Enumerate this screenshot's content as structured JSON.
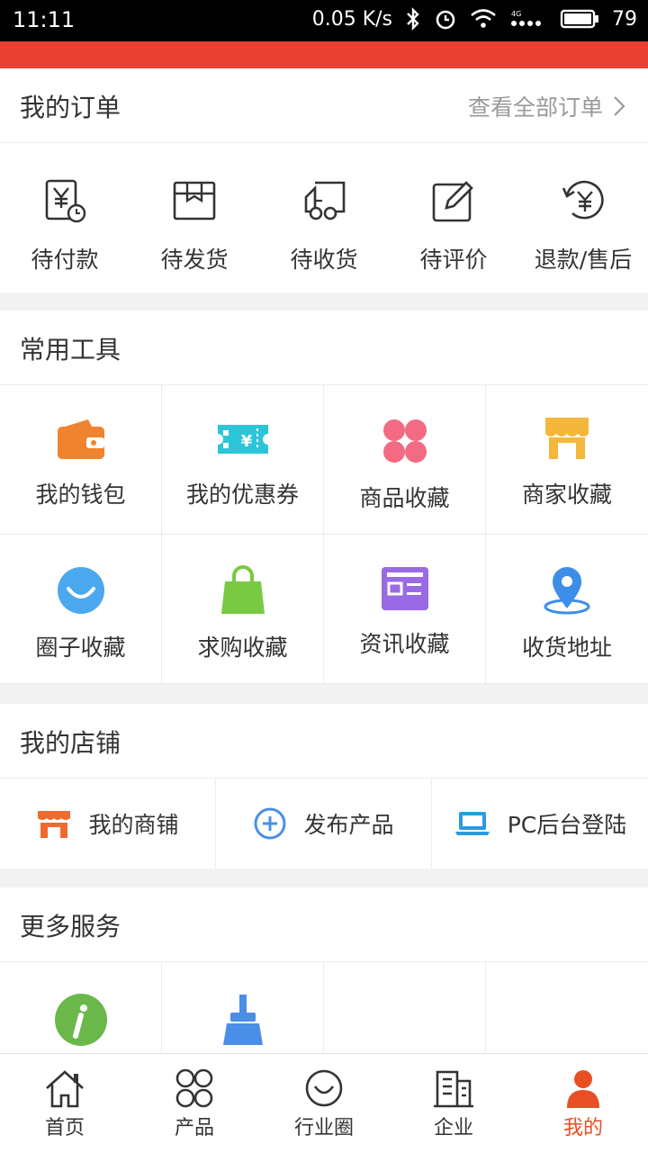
{
  "status": {
    "time": "11:11",
    "speed": "0.05 K/s",
    "battery": "79"
  },
  "orders": {
    "title": "我的订单",
    "view_all": "查看全部订单",
    "items": [
      {
        "label": "待付款",
        "icon": "yuan-clock-icon"
      },
      {
        "label": "待发货",
        "icon": "package-box-icon"
      },
      {
        "label": "待收货",
        "icon": "delivery-truck-icon"
      },
      {
        "label": "待评价",
        "icon": "edit-pencil-icon"
      },
      {
        "label": "退款/售后",
        "icon": "refund-yuan-icon"
      }
    ]
  },
  "tools": {
    "title": "常用工具",
    "items": [
      {
        "label": "我的钱包",
        "icon": "wallet-icon",
        "color": "#f0832e"
      },
      {
        "label": "我的优惠券",
        "icon": "coupon-icon",
        "color": "#2ec5d9"
      },
      {
        "label": "商品收藏",
        "icon": "clover-icon",
        "color": "#f36a83"
      },
      {
        "label": "商家收藏",
        "icon": "shop-awning-icon",
        "color": "#f5b73b"
      },
      {
        "label": "圈子收藏",
        "icon": "smile-circle-icon",
        "color": "#4ba8ee"
      },
      {
        "label": "求购收藏",
        "icon": "shopping-bag-icon",
        "color": "#7ac943"
      },
      {
        "label": "资讯收藏",
        "icon": "news-card-icon",
        "color": "#9a6ae5"
      },
      {
        "label": "收货地址",
        "icon": "location-pin-icon",
        "color": "#3d8ee8"
      }
    ]
  },
  "shop": {
    "title": "我的店铺",
    "items": [
      {
        "label": "我的商铺",
        "icon": "storefront-icon",
        "color": "#f06a2e"
      },
      {
        "label": "发布产品",
        "icon": "plus-circle-icon",
        "color": "#4a90e2"
      },
      {
        "label": "PC后台登陆",
        "icon": "laptop-icon",
        "color": "#2b9be0"
      }
    ]
  },
  "more": {
    "title": "更多服务",
    "items": [
      {
        "icon": "info-circle-icon",
        "color": "#6bb84a"
      },
      {
        "icon": "broom-icon",
        "color": "#4a8ee8"
      }
    ]
  },
  "tabs": [
    {
      "label": "首页",
      "icon": "home-icon"
    },
    {
      "label": "产品",
      "icon": "grid-products-icon"
    },
    {
      "label": "行业圈",
      "icon": "circle-smile-icon"
    },
    {
      "label": "企业",
      "icon": "building-icon"
    },
    {
      "label": "我的",
      "icon": "user-icon",
      "active": true
    }
  ],
  "colors": {
    "brand": "#e94033",
    "active_tab": "#e94f24"
  }
}
